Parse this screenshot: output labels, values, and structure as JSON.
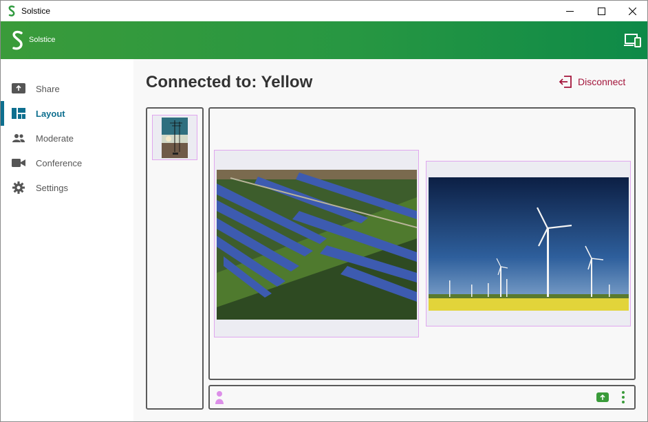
{
  "window": {
    "title": "Solstice"
  },
  "header": {
    "brand": "Solstice"
  },
  "sidebar": {
    "items": [
      {
        "label": "Share",
        "icon": "share-icon",
        "active": false
      },
      {
        "label": "Layout",
        "icon": "layout-icon",
        "active": true
      },
      {
        "label": "Moderate",
        "icon": "people-icon",
        "active": false
      },
      {
        "label": "Conference",
        "icon": "video-camera-icon",
        "active": false
      },
      {
        "label": "Settings",
        "icon": "gear-icon",
        "active": false
      }
    ]
  },
  "main": {
    "heading": "Connected to: Yellow",
    "disconnect_label": "Disconnect",
    "posts": [
      {
        "name": "solar-farm-post",
        "subject": "aerial view of solar panel field"
      },
      {
        "name": "wind-turbines-post",
        "subject": "wind turbines over yellow field"
      }
    ]
  },
  "colors": {
    "brand_green": "#2f9a3e",
    "accent_blue": "#0e6f8f",
    "disconnect_red": "#a3143a",
    "post_border": "#e0a6ee"
  }
}
